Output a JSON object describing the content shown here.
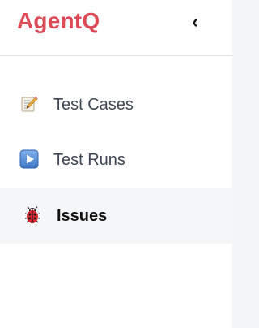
{
  "brand": {
    "name": "AgentQ",
    "color": "#dc4a58"
  },
  "header": {
    "collapse_label": "‹"
  },
  "nav": {
    "items": [
      {
        "label": "Test Cases",
        "icon": "memo-pencil-icon",
        "active": false
      },
      {
        "label": "Test Runs",
        "icon": "play-button-icon",
        "active": false
      },
      {
        "label": "Issues",
        "icon": "ladybug-icon",
        "active": true
      }
    ]
  }
}
